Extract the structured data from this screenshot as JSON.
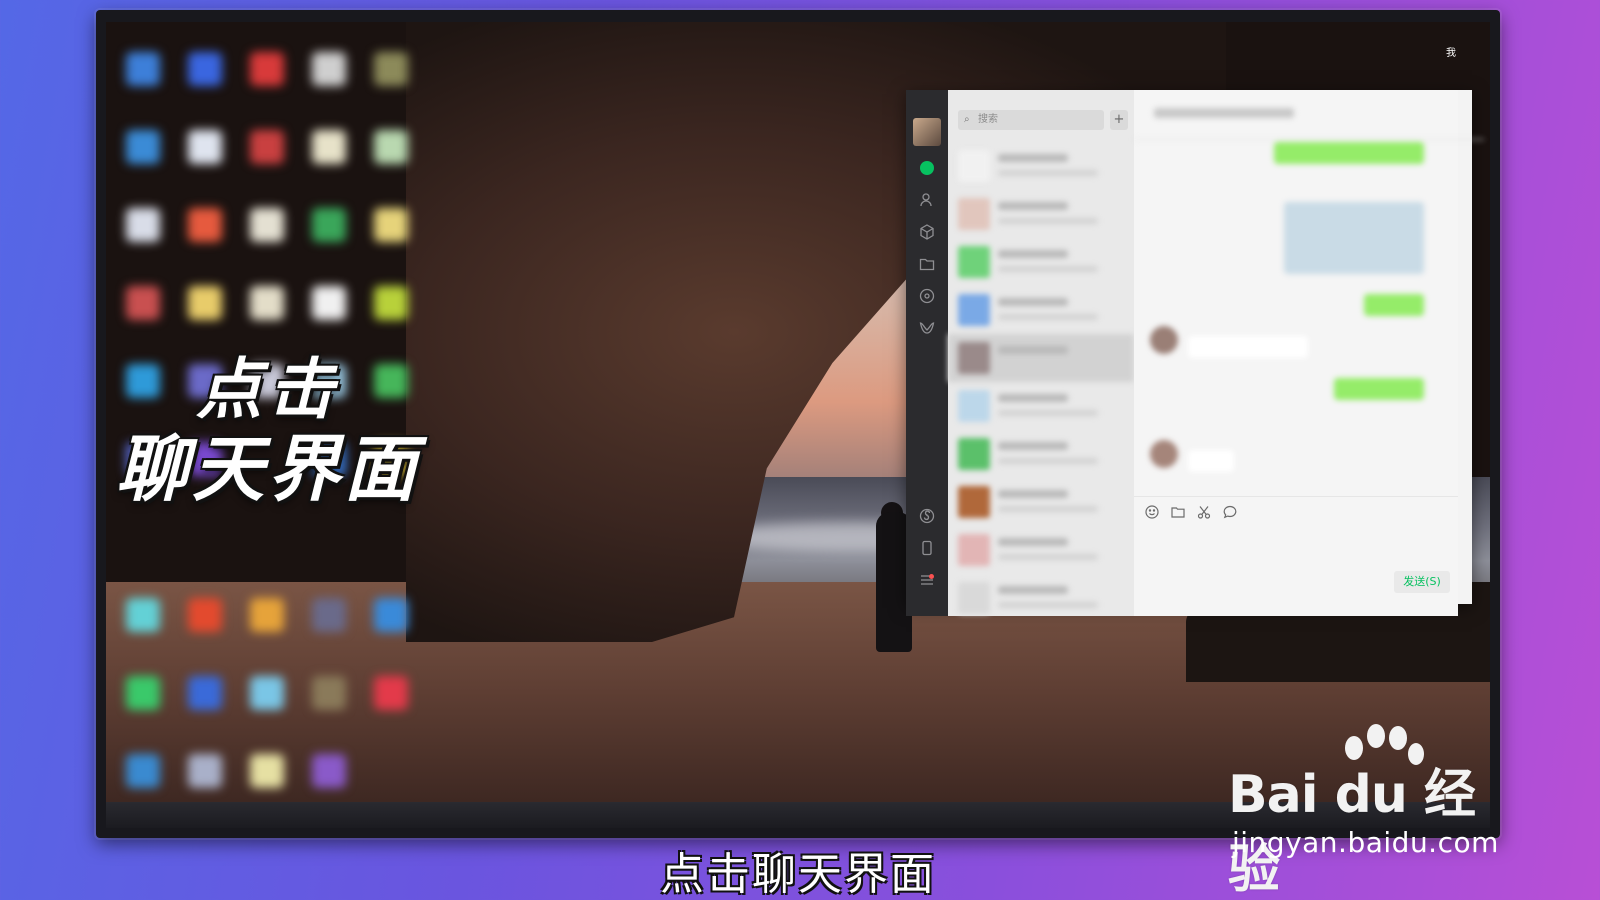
{
  "overlay": {
    "line1": "点击",
    "line2": "聊天界面"
  },
  "subtitle": "点击聊天界面",
  "watermark": {
    "brand": "Bai du 经验",
    "url": "jingyan.baidu.com"
  },
  "desktop": {
    "corner_label": "我"
  },
  "wechat": {
    "search_placeholder": "搜索",
    "add_label": "+",
    "send_button": "发送(S)",
    "accent_color": "#07c160",
    "sidebar_icons": [
      "chat-icon",
      "contacts-icon",
      "favorites-icon",
      "files-icon",
      "moments-icon",
      "channels-icon",
      "mini-program-icon",
      "phone-icon",
      "menu-icon"
    ],
    "toolbar_icons": [
      "emoji-icon",
      "folder-icon",
      "scissors-icon",
      "chat-history-icon"
    ]
  }
}
